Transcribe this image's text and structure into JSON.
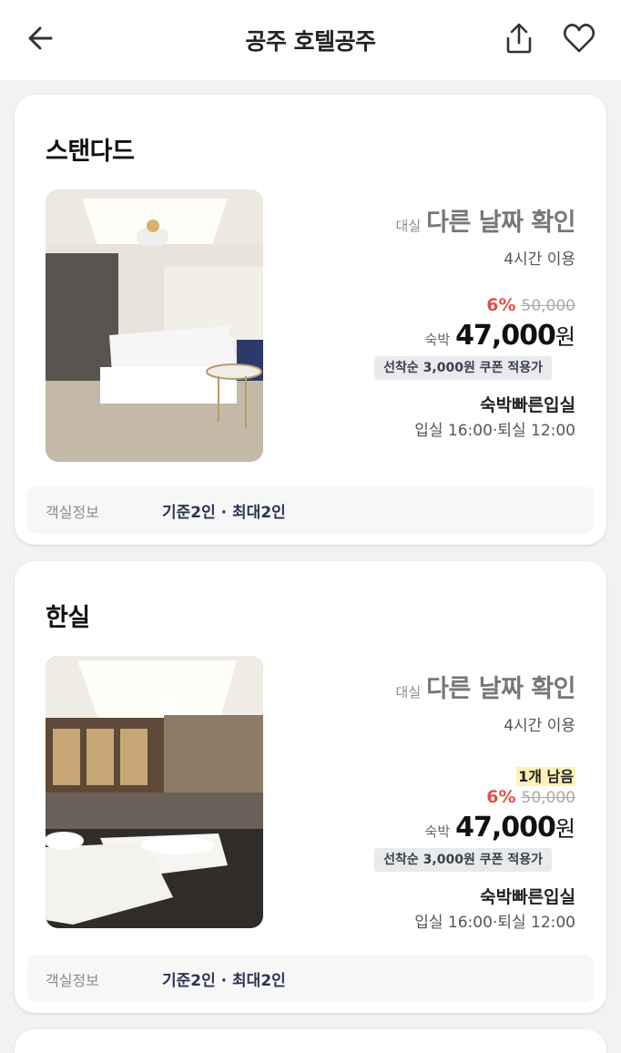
{
  "header": {
    "title": "공주 호텔공주",
    "back_icon": "back-arrow-icon",
    "share_icon": "share-icon",
    "favorite_icon": "heart-icon"
  },
  "rooms": [
    {
      "name": "스탠다드",
      "daesil_label": "대실",
      "daesil_value": "다른 날짜 확인",
      "hours": "4시간 이용",
      "remaining": "",
      "discount": "6%",
      "original_price": "50,000",
      "price_label": "숙박",
      "price": "47,000",
      "price_unit": "원",
      "coupon": "선착순 3,000원 쿠폰 적용가",
      "checkin_type": "숙박빠른입실",
      "checkin_time": "입실 16:00·퇴실 12:00",
      "info_label": "객실정보",
      "info_value": "기준2인 · 최대2인"
    },
    {
      "name": "한실",
      "daesil_label": "대실",
      "daesil_value": "다른 날짜 확인",
      "hours": "4시간 이용",
      "remaining": "1개 남음",
      "discount": "6%",
      "original_price": "50,000",
      "price_label": "숙박",
      "price": "47,000",
      "price_unit": "원",
      "coupon": "선착순 3,000원 쿠폰 적용가",
      "checkin_type": "숙박빠른입실",
      "checkin_time": "입실 16:00·퇴실 12:00",
      "info_label": "객실정보",
      "info_value": "기준2인 · 최대2인"
    }
  ],
  "colors": {
    "discount": "#e0504a",
    "highlight": "#fff1b8",
    "coupon_bg": "#e8eaee"
  }
}
